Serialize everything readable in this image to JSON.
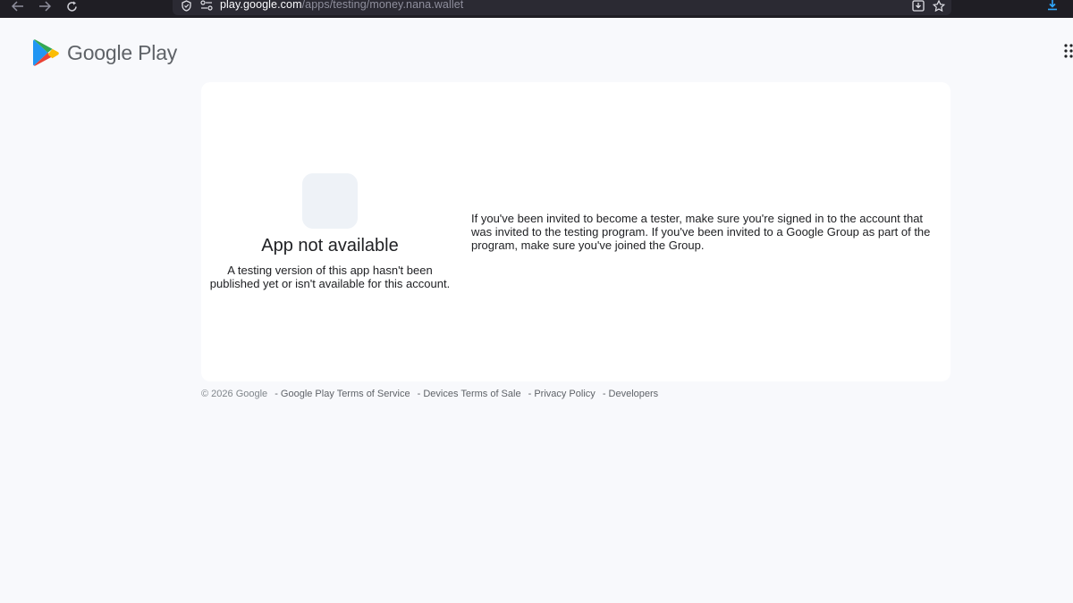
{
  "browser": {
    "url_host": "play.google.com",
    "url_path": "/apps/testing/money.nana.wallet"
  },
  "header": {
    "brand": "Google Play"
  },
  "card": {
    "title": "App not available",
    "subtitle": "A testing version of this app hasn't been published yet or isn't available for this account.",
    "info": "If you've been invited to become a tester, make sure you're signed in to the account that was invited to the testing program. If you've been invited to a Google Group as part of the program, make sure you've joined the Group."
  },
  "footer": {
    "copyright": "© 2026 Google",
    "links": [
      "Google Play Terms of Service",
      "Devices Terms of Sale",
      "Privacy Policy",
      "Developers"
    ]
  },
  "colors": {
    "page_bg": "#f8f9fc",
    "card_bg": "#ffffff",
    "download_accent": "#0a84ff"
  }
}
